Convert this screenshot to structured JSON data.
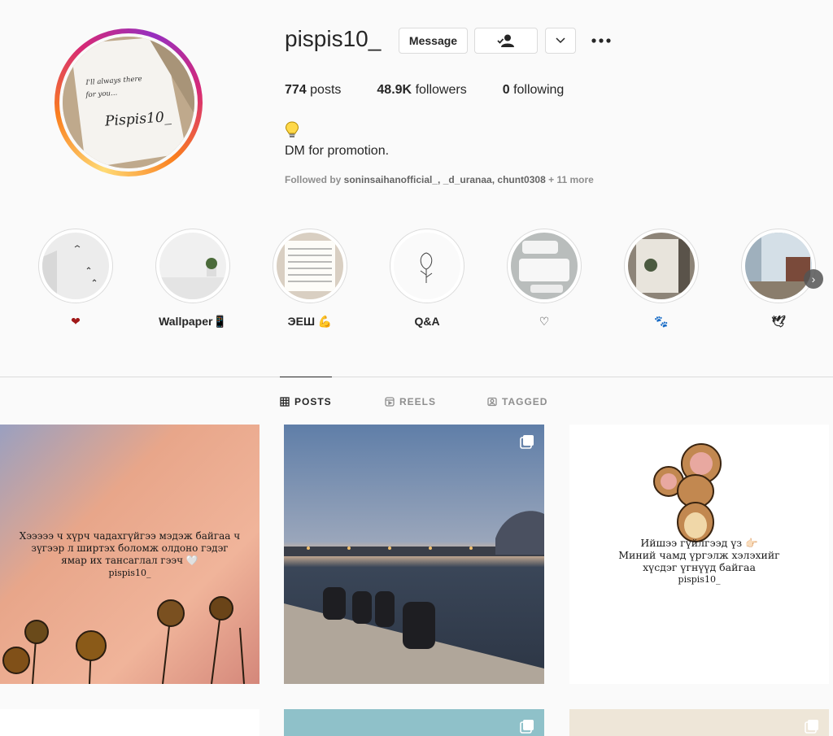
{
  "profile": {
    "username": "pispis10_",
    "avatar_text_1": "I'll always there",
    "avatar_text_2": "for you...",
    "avatar_text_3": "Pispis10_",
    "message_label": "Message",
    "stats": [
      {
        "count": "774",
        "label": "posts"
      },
      {
        "count": "48.9K",
        "label": "followers"
      },
      {
        "count": "0",
        "label": "following"
      }
    ],
    "bio_icon": "lightbulb-icon",
    "bio": "DM for promotion.",
    "followed_by_prefix": "Followed by ",
    "followed_by_names": "soninsaihanofficial_, _d_uranaa, chunt0308",
    "followed_by_more": " + 11 more"
  },
  "highlights": [
    {
      "label": "❤",
      "name": "highlight-hearts"
    },
    {
      "label": "Wallpaper📱",
      "name": "highlight-wallpaper"
    },
    {
      "label": "ЭЕШ 💪",
      "name": "highlight-eesh"
    },
    {
      "label": "Q&A",
      "name": "highlight-qa"
    },
    {
      "label": "♡",
      "name": "highlight-heart-outline"
    },
    {
      "label": "🐾",
      "name": "highlight-paws"
    },
    {
      "label": "🕊",
      "name": "highlight-dove"
    }
  ],
  "tabs": [
    {
      "label": "POSTS",
      "icon": "grid-icon"
    },
    {
      "label": "REELS",
      "icon": "reels-icon"
    },
    {
      "label": "TAGGED",
      "icon": "tagged-icon"
    }
  ],
  "posts": {
    "p1": {
      "line1": "Хэээээ ч хүрч чадахгүйгээ мэдэж байгаа ч",
      "line2": "зүгээр л ширтэх боломж олдоно гэдэг",
      "line3": "ямар их тансаглал гээч 🤍",
      "sig": "pispis10_"
    },
    "p3": {
      "line1": "Ийшээ гүйлгээд үз 👉🏻",
      "line2": "Миний чамд үргэлж хэлэхийг",
      "line3": "хүсдэг үгнүүд байгаа",
      "sig": "pispis10_"
    }
  },
  "colors": {
    "accent": "#0095f6",
    "text": "#262626",
    "muted": "#8e8e8e",
    "border": "#dbdbdb"
  }
}
